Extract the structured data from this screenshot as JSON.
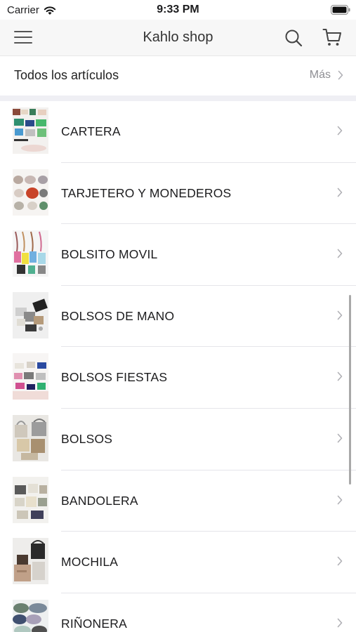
{
  "status_bar": {
    "carrier": "Carrier",
    "time": "9:33 PM"
  },
  "nav": {
    "title": "Kahlo shop"
  },
  "all_items": {
    "label": "Todos los artículos",
    "more": "Más"
  },
  "categories": [
    {
      "label": "CARTERA",
      "thumb": "wallets-thumbnail"
    },
    {
      "label": "TARJETERO Y MONEDEROS",
      "thumb": "card-holders-thumbnail"
    },
    {
      "label": "BOLSITO MOVIL",
      "thumb": "phone-bags-thumbnail"
    },
    {
      "label": "BOLSOS DE MANO",
      "thumb": "handbags-thumbnail"
    },
    {
      "label": "BOLSOS FIESTAS",
      "thumb": "party-bags-thumbnail"
    },
    {
      "label": "BOLSOS",
      "thumb": "bags-thumbnail"
    },
    {
      "label": "BANDOLERA",
      "thumb": "crossbody-bags-thumbnail"
    },
    {
      "label": "MOCHILA",
      "thumb": "backpacks-thumbnail"
    },
    {
      "label": "RIÑONERA",
      "thumb": "waist-bags-thumbnail"
    }
  ],
  "colors": {
    "nav_background": "#f7f7f7",
    "divider": "#e5e5ea",
    "secondary_text": "#8e8e93",
    "section_gap": "#efeff4"
  }
}
